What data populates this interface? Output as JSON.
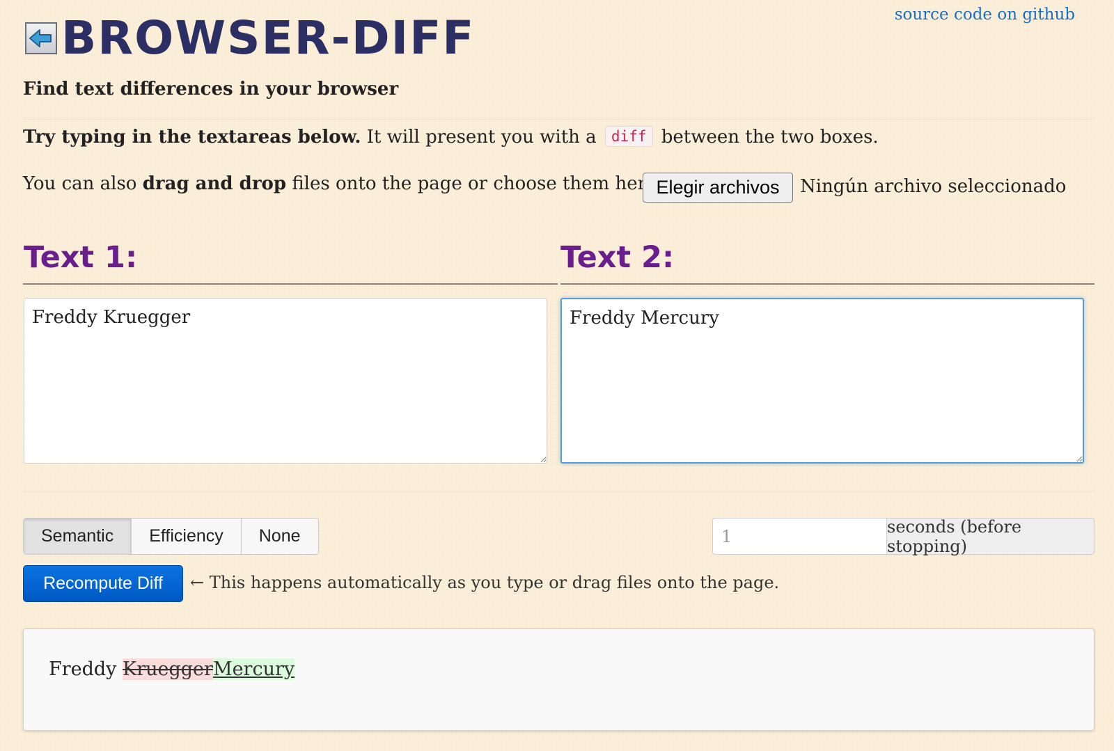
{
  "header": {
    "github_link": "source code on github",
    "title": "BROWSER-DIFF",
    "tagline": "Find text differences in your browser",
    "logo_icon": "back-arrow-icon"
  },
  "intro": {
    "bold_lead": "Try typing in the textareas below.",
    "before_code": " It will present you with a ",
    "code": "diff",
    "after_code": " between the two boxes."
  },
  "drag": {
    "prefix": "You can also ",
    "bold": "drag and drop",
    "suffix": " files onto the page or choose them here:",
    "file_button": "Elegir archivos",
    "file_status": "Ningún archivo seleccionado"
  },
  "columns": {
    "left_title": "Text 1:",
    "right_title": "Text 2:",
    "left_text": "Freddy Kruegger",
    "right_text": "Freddy Mercury"
  },
  "cleanup": {
    "options": [
      "Semantic",
      "Efficiency",
      "None"
    ],
    "selected": "Semantic"
  },
  "timeout": {
    "value": "1",
    "addon": "seconds (before stopping)"
  },
  "recompute": {
    "button": "Recompute Diff",
    "note": "← This happens automatically as you type or drag files onto the page."
  },
  "diff": {
    "equal": "Freddy ",
    "deleted": "Kruegger",
    "inserted": "Mercury"
  },
  "colors": {
    "title": "#2c2f63",
    "column_title": "#6a1e8e",
    "link": "#1a6fc4",
    "primary_button": "#0b6bd6",
    "deleted_bg": "#fbdcdc",
    "inserted_bg": "#dcfadc"
  }
}
